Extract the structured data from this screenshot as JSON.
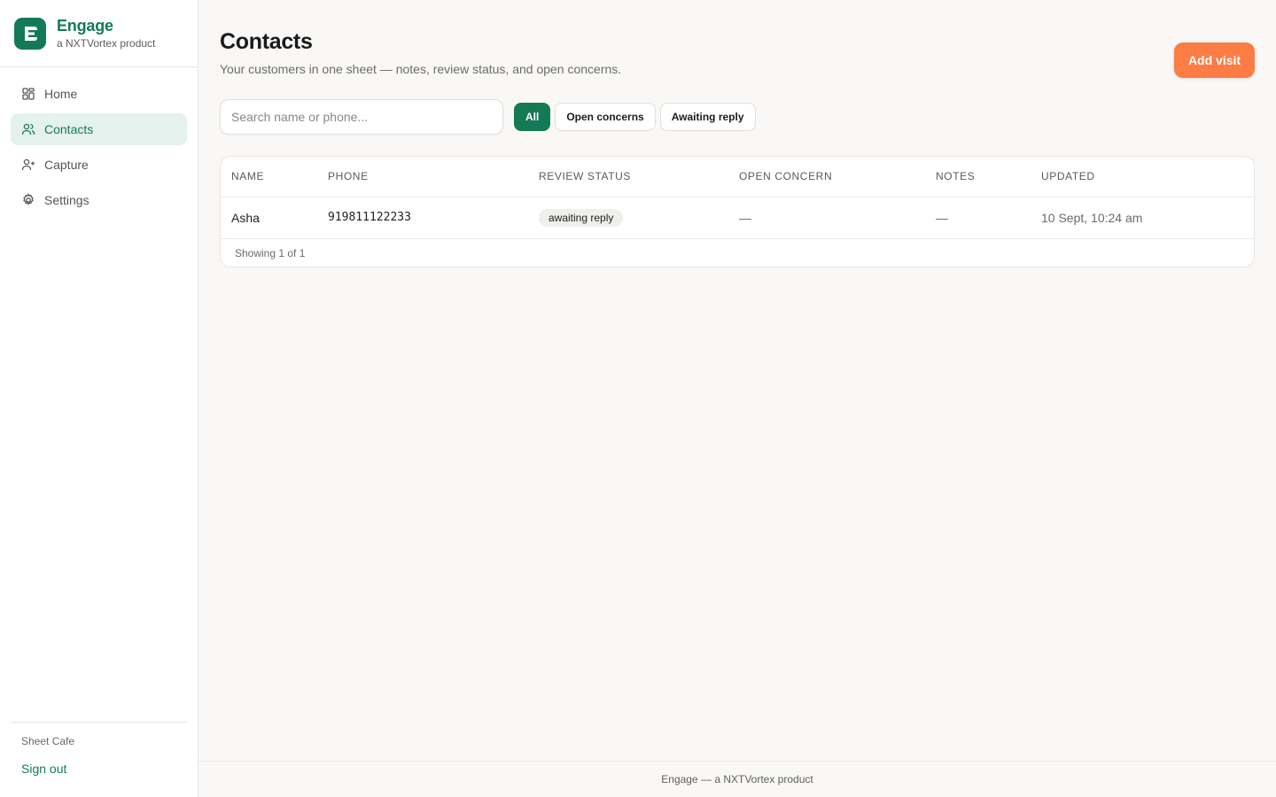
{
  "brand": {
    "name": "Engage",
    "tagline": "a NXTVortex product",
    "accent_color": "#147a56"
  },
  "sidebar": {
    "items": [
      {
        "label": "Home",
        "icon": "grid-icon",
        "active": false
      },
      {
        "label": "Contacts",
        "icon": "users-icon",
        "active": true
      },
      {
        "label": "Capture",
        "icon": "user-plus-icon",
        "active": false
      },
      {
        "label": "Settings",
        "icon": "gear-icon",
        "active": false
      }
    ],
    "org_name": "Sheet Cafe",
    "signout_label": "Sign out"
  },
  "page": {
    "title": "Contacts",
    "subtitle": "Your customers in one sheet — notes, review status, and open concerns.",
    "add_button_label": "Add visit",
    "add_button_color": "#fb7d45"
  },
  "search": {
    "placeholder": "Search name or phone...",
    "value": ""
  },
  "filters": [
    {
      "label": "All",
      "active": true
    },
    {
      "label": "Open concerns",
      "active": false
    },
    {
      "label": "Awaiting reply",
      "active": false
    }
  ],
  "table": {
    "columns": [
      "NAME",
      "PHONE",
      "REVIEW STATUS",
      "OPEN CONCERN",
      "NOTES",
      "UPDATED"
    ],
    "rows": [
      {
        "name": "Asha",
        "phone": "919811122233",
        "review_status": "awaiting reply",
        "open_concern": "—",
        "notes": "—",
        "updated": "10 Sept, 10:24 am"
      }
    ],
    "showing": "Showing 1 of 1"
  },
  "footer": {
    "text": "Engage — a NXTVortex product"
  }
}
